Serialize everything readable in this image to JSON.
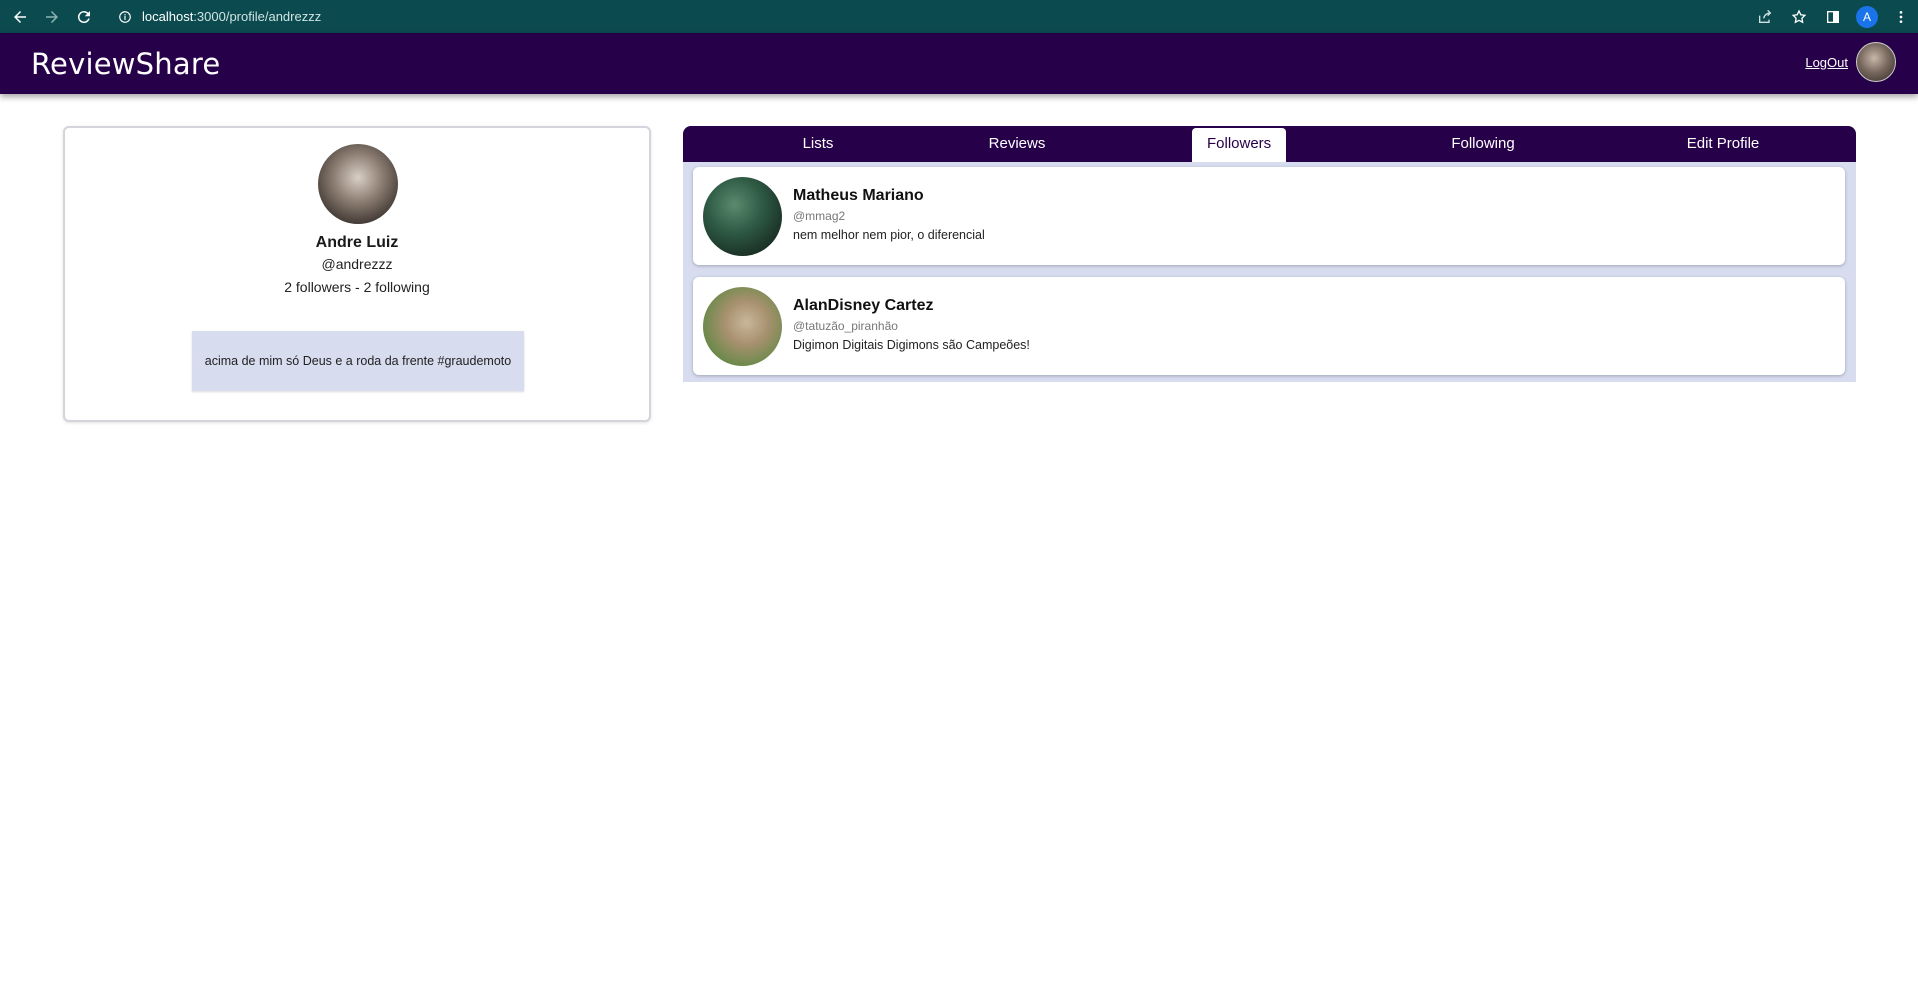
{
  "browser": {
    "url_host": "localhost",
    "url_path": ":3000/profile/andrezzz",
    "profile_initial": "A"
  },
  "header": {
    "brand": "ReviewShare",
    "logout": "LogOut"
  },
  "profile": {
    "name": "Andre Luiz",
    "handle": "@andrezzz",
    "stats": "2 followers - 2 following",
    "bio": "acima de mim só Deus e a roda da frente #graudemoto"
  },
  "tabs": [
    {
      "label": "Lists",
      "active": false
    },
    {
      "label": "Reviews",
      "active": false
    },
    {
      "label": "Followers",
      "active": true
    },
    {
      "label": "Following",
      "active": false
    },
    {
      "label": "Edit Profile",
      "active": false
    }
  ],
  "followers": [
    {
      "name": "Matheus Mariano",
      "handle": "@mmag2",
      "bio": "nem melhor nem pior, o diferencial"
    },
    {
      "name": "AlanDisney Cartez",
      "handle": "@tatuzão_piranhão",
      "bio": "Digimon Digitais Digimons são Campeões!"
    }
  ],
  "colors": {
    "header_bg": "#27004a",
    "browser_bg": "#0b4a4f",
    "panel_bg": "#d7dcef"
  }
}
